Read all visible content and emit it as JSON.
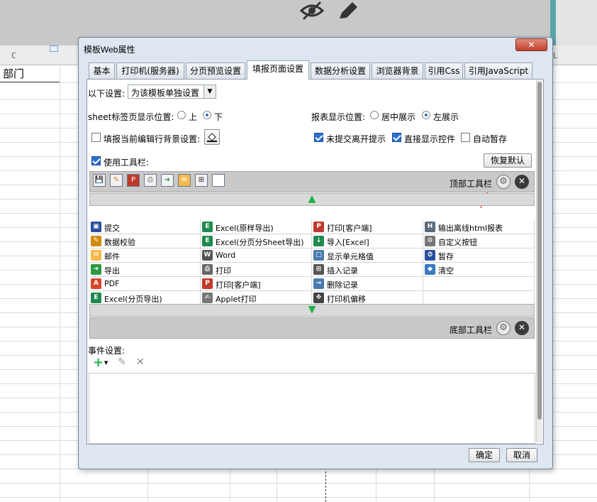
{
  "spreadsheet": {
    "column_headers": [
      "C",
      "L"
    ],
    "cell_text": "部门"
  },
  "dialog": {
    "title": "模板Web属性",
    "close_label": "✕",
    "tabs": [
      {
        "label": "基本"
      },
      {
        "label": "打印机(服务器)"
      },
      {
        "label": "分页预览设置"
      },
      {
        "label": "填报页面设置"
      },
      {
        "label": "数据分析设置"
      },
      {
        "label": "浏览器背景"
      },
      {
        "label": "引用Css"
      },
      {
        "label": "引用JavaScript"
      }
    ],
    "active_tab": "填报页面设置",
    "settings_label": "以下设置:",
    "settings_select_value": "为该模板单独设置",
    "sheet_tab_position_label": "sheet标签页显示位置:",
    "sheet_tab_options": [
      "上",
      "下"
    ],
    "sheet_tab_selected": "下",
    "report_position_label": "报表显示位置:",
    "report_position_options": [
      "居中展示",
      "左展示"
    ],
    "report_position_selected": "左展示",
    "edit_row_bg_label": "填报当前编辑行背景设置:",
    "edit_row_bg_checked": false,
    "unsubmitted_prompt_label": "未提交离开提示",
    "unsubmitted_prompt_checked": true,
    "direct_show_control_label": "直接显示控件",
    "direct_show_control_checked": true,
    "autosave_label": "自动暂存",
    "autosave_checked": false,
    "use_toolbar_label": "使用工具栏:",
    "use_toolbar_checked": true,
    "restore_default_label": "恢复默认",
    "top_toolbar_label": "顶部工具栏",
    "bottom_toolbar_label": "底部工具栏",
    "top_toolbar_icons": [
      "save-icon",
      "verify-icon",
      "pdf-print-icon",
      "print-icon",
      "export-icon",
      "email-icon",
      "insert-row-icon",
      "show-cell-icon"
    ],
    "button_grid": [
      [
        "提交",
        "Excel(原样导出)",
        "打印[客户端]",
        "输出离线html报表"
      ],
      [
        "数据校验",
        "Excel(分页分Sheet导出)",
        "导入[Excel]",
        "自定义按钮"
      ],
      [
        "邮件",
        "Word",
        "显示单元格值",
        "暂存"
      ],
      [
        "导出",
        "打印",
        "插入记录",
        "清空"
      ],
      [
        "PDF",
        "打印[客户端]",
        "删除记录",
        ""
      ],
      [
        "Excel(分页导出)",
        "Applet打印",
        "打印机偏移",
        ""
      ]
    ],
    "button_grid_icons": [
      [
        "save-icon",
        "excel-icon",
        "pdf-print-icon",
        "html-export-icon"
      ],
      [
        "verify-icon",
        "excel-icon",
        "excel-import-icon",
        "custom-gear-icon"
      ],
      [
        "email-icon",
        "word-icon",
        "show-cell-icon",
        "stash-icon"
      ],
      [
        "export-icon",
        "print-icon",
        "insert-row-icon",
        "eraser-icon"
      ],
      [
        "pdf-icon",
        "pdf-print-icon",
        "delete-row-icon",
        ""
      ],
      [
        "excel-icon",
        "applet-print-icon",
        "move-icon",
        ""
      ]
    ],
    "event_settings_label": "事件设置:",
    "ok_label": "确定",
    "cancel_label": "取消"
  },
  "colors": {
    "dialog_bg": "#dde6f1",
    "accent_blue": "#2a6fd1",
    "green_arrow": "#1bb14a",
    "red_annotation": "#e02020"
  }
}
